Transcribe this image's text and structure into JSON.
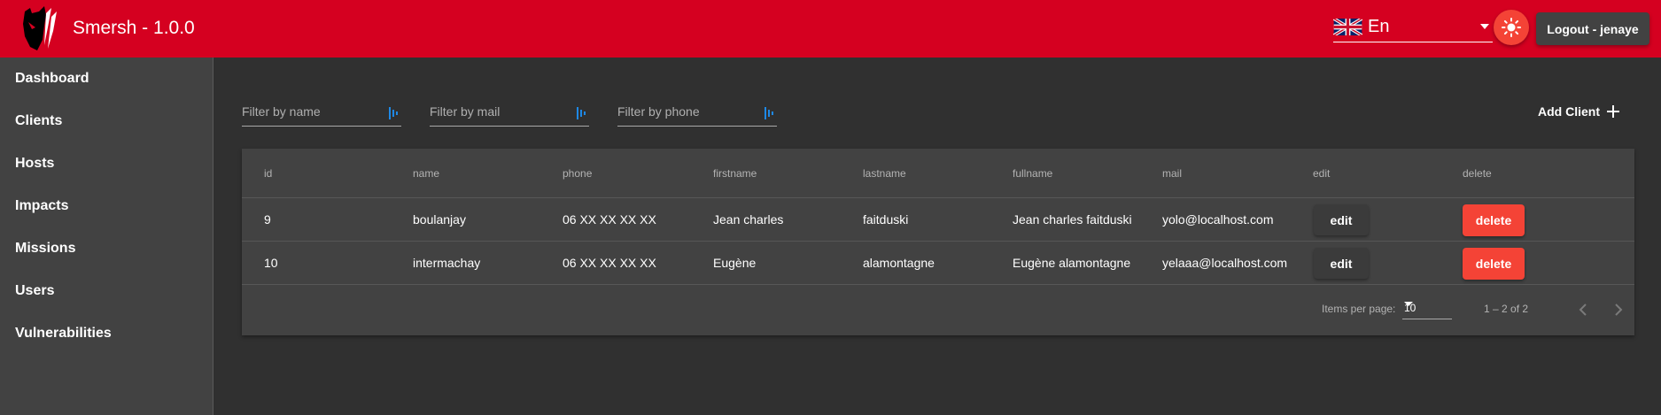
{
  "header": {
    "title": "Smersh - 1.0.0",
    "language": {
      "value": "En",
      "flag_icon": "uk-flag-icon"
    },
    "theme_icon": "sun-icon",
    "logout_label": "Logout - jenaye",
    "colors": {
      "toolbar": "#d50020",
      "accent": "#f44336"
    }
  },
  "sidebar": {
    "items": [
      {
        "label": "Dashboard"
      },
      {
        "label": "Clients"
      },
      {
        "label": "Hosts"
      },
      {
        "label": "Impacts"
      },
      {
        "label": "Missions"
      },
      {
        "label": "Users"
      },
      {
        "label": "Vulnerabilities"
      }
    ]
  },
  "filters": {
    "name_placeholder": "Filter by name",
    "mail_placeholder": "Filter by mail",
    "phone_placeholder": "Filter by phone"
  },
  "add_client_label": "Add Client",
  "table": {
    "columns": [
      "id",
      "name",
      "phone",
      "firstname",
      "lastname",
      "fullname",
      "mail",
      "edit",
      "delete"
    ],
    "rows": [
      {
        "id": "9",
        "name": "boulanjay",
        "phone": "06 XX XX XX XX",
        "firstname": "Jean charles",
        "lastname": "faitduski",
        "fullname": "Jean charles faitduski",
        "mail": "yolo@localhost.com",
        "edit": "edit",
        "delete": "delete"
      },
      {
        "id": "10",
        "name": "intermachay",
        "phone": "06 XX XX XX XX",
        "firstname": "Eugène",
        "lastname": "alamontagne",
        "fullname": "Eugène alamontagne",
        "mail": "yelaaa@localhost.com",
        "edit": "edit",
        "delete": "delete"
      }
    ]
  },
  "paginator": {
    "items_per_page_label": "Items per page:",
    "page_size": "10",
    "range_label": "1 – 2 of 2"
  }
}
